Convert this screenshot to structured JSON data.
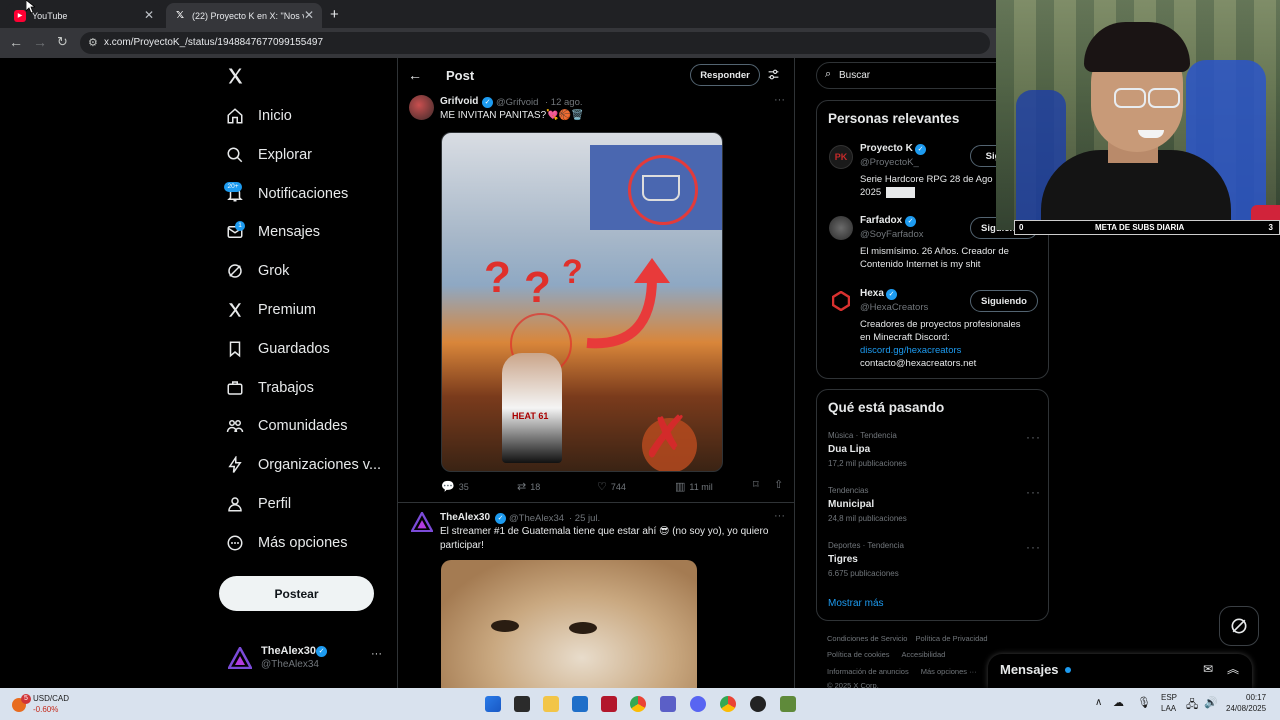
{
  "browser": {
    "tabs": [
      {
        "title": "YouTube"
      },
      {
        "title": "(22) Proyecto K en X: \"Nos vem"
      }
    ],
    "url": "x.com/ProyectoK_/status/1948847677099155497"
  },
  "nav": {
    "items": [
      {
        "label": "Inicio"
      },
      {
        "label": "Explorar"
      },
      {
        "label": "Notificaciones",
        "badge": "20+"
      },
      {
        "label": "Mensajes",
        "badge": "1"
      },
      {
        "label": "Grok"
      },
      {
        "label": "Premium"
      },
      {
        "label": "Guardados"
      },
      {
        "label": "Trabajos"
      },
      {
        "label": "Comunidades"
      },
      {
        "label": "Organizaciones v..."
      },
      {
        "label": "Perfil"
      },
      {
        "label": "Más opciones"
      }
    ],
    "post_button": "Postear",
    "account": {
      "name": "TheAlex30",
      "handle": "@TheAlex34"
    }
  },
  "main": {
    "header_title": "Post",
    "reply_button": "Responder",
    "tweets": [
      {
        "name": "Grifvoid",
        "handle": "@Grifvoid",
        "date": "· 12 ago.",
        "text": "ME INVITAN PANITAS?💘🏀🗑️",
        "image_label": "?",
        "jersey_text": "HEAT 61",
        "stats": {
          "replies": "35",
          "reposts": "18",
          "likes": "744",
          "views": "11 mil"
        }
      },
      {
        "name": "TheAlex30",
        "handle": "@TheAlex34",
        "date": "· 25 jul.",
        "text_line1": "El streamer #1 de Guatemala tiene que estar ahí 😎 (no soy yo), yo quiero",
        "text_line2": "participar!"
      }
    ]
  },
  "right": {
    "search_placeholder": "Buscar",
    "relevant_title": "Personas relevantes",
    "people": [
      {
        "name": "Proyecto K",
        "handle": "@ProyectoK_",
        "bio1": "Serie Hardcore RPG 28 de Ago",
        "bio2": "2025",
        "button": "Sig"
      },
      {
        "name": "Farfadox",
        "handle": "@SoyFarfadox",
        "bio1": "El mismísimo. 26 Años. Creador de",
        "bio2": "Contenido Internet is my shit",
        "button": "Siguiendo"
      },
      {
        "name": "Hexa",
        "handle": "@HexaCreators",
        "bio1": "Creadores de proyectos profesionales",
        "bio2": "en Minecraft Discord:",
        "link": "discord.gg/hexacreators",
        "bio3": "contacto@hexacreators.net",
        "button": "Siguiendo"
      }
    ],
    "trends_title": "Qué está pasando",
    "trends": [
      {
        "context": "Música · Tendencia",
        "topic": "Dua Lipa",
        "count": "17,2 mil publicaciones"
      },
      {
        "context": "Tendencias",
        "topic": "Municipal",
        "count": "24,8 mil publicaciones"
      },
      {
        "context": "Deportes · Tendencia",
        "topic": "Tigres",
        "count": "6.675 publicaciones"
      }
    ],
    "show_more": "Mostrar más",
    "footer": {
      "line1a": "Condiciones de Servicio",
      "line1b": "Política de Privacidad",
      "line2a": "Política de cookies",
      "line2b": "Accesibilidad",
      "line3a": "Información de anuncios",
      "line3b": "Más opciones ···",
      "copyright": "© 2025 X Corp."
    }
  },
  "overlay": {
    "subs_left": "0",
    "subs_label": "META DE SUBS DIARIA",
    "subs_right": "3"
  },
  "messages_drawer": {
    "title": "Mensajes"
  },
  "taskbar": {
    "ticker_name": "USD/CAD",
    "ticker_change": "-0.60%",
    "ticker_badge": "5",
    "lang1": "ESP",
    "lang2": "LAA",
    "time": "00:17",
    "date": "24/08/2025"
  },
  "colors": {
    "accent": "#1d9bf0",
    "background": "#000000",
    "muted": "#71767b",
    "taskbar": "#d9e2ee"
  }
}
